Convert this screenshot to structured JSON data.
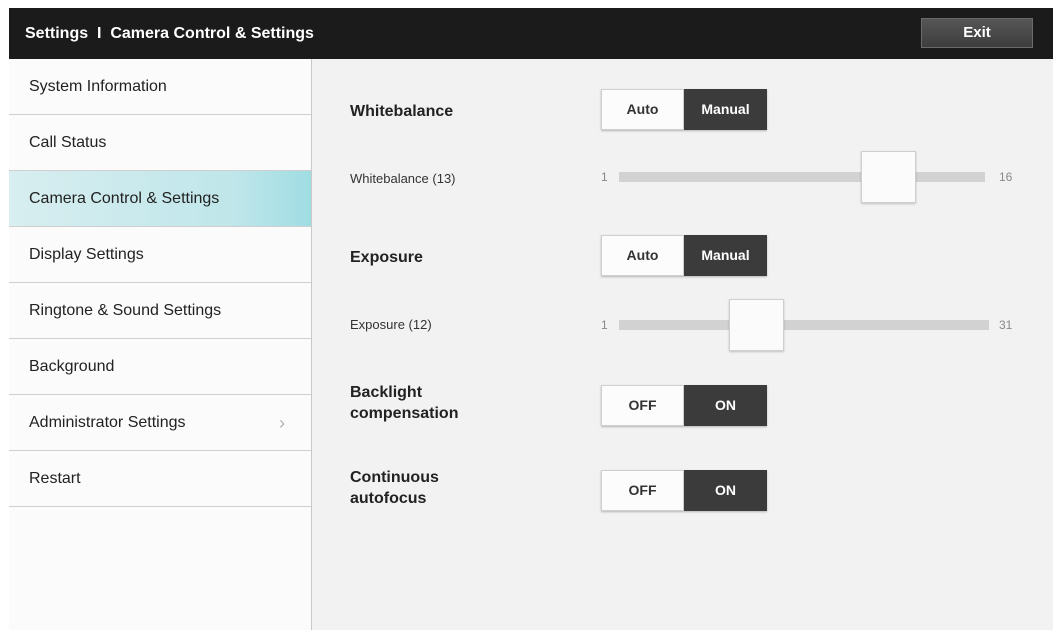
{
  "header": {
    "title": "Settings  I  Camera Control & Settings",
    "exit_label": "Exit"
  },
  "sidebar": {
    "items": [
      {
        "label": "System Information"
      },
      {
        "label": "Call Status"
      },
      {
        "label": "Camera Control & Settings",
        "active": true
      },
      {
        "label": "Display Settings"
      },
      {
        "label": "Ringtone & Sound Settings"
      },
      {
        "label": "Background"
      },
      {
        "label": "Administrator Settings",
        "has_chevron": true
      },
      {
        "label": "Restart"
      }
    ]
  },
  "settings": {
    "whitebalance": {
      "label": "Whitebalance",
      "options": [
        "Auto",
        "Manual"
      ],
      "selected": "Manual"
    },
    "whitebalance_slider": {
      "label": "Whitebalance (13)",
      "min": "1",
      "max": "16",
      "value": 13
    },
    "exposure": {
      "label": "Exposure",
      "options": [
        "Auto",
        "Manual"
      ],
      "selected": "Manual"
    },
    "exposure_slider": {
      "label": "Exposure (12)",
      "min": "1",
      "max": "31",
      "value": 12
    },
    "backlight": {
      "label_line1": "Backlight",
      "label_line2": "compensation",
      "options": [
        "OFF",
        "ON"
      ],
      "selected": "ON"
    },
    "autofocus": {
      "label_line1": "Continuous",
      "label_line2": "autofocus",
      "options": [
        "OFF",
        "ON"
      ],
      "selected": "ON"
    }
  },
  "colors": {
    "header_bg": "#1b1b1b",
    "active_item": "#bfe6ea",
    "toggle_on": "#3b3b3b"
  }
}
